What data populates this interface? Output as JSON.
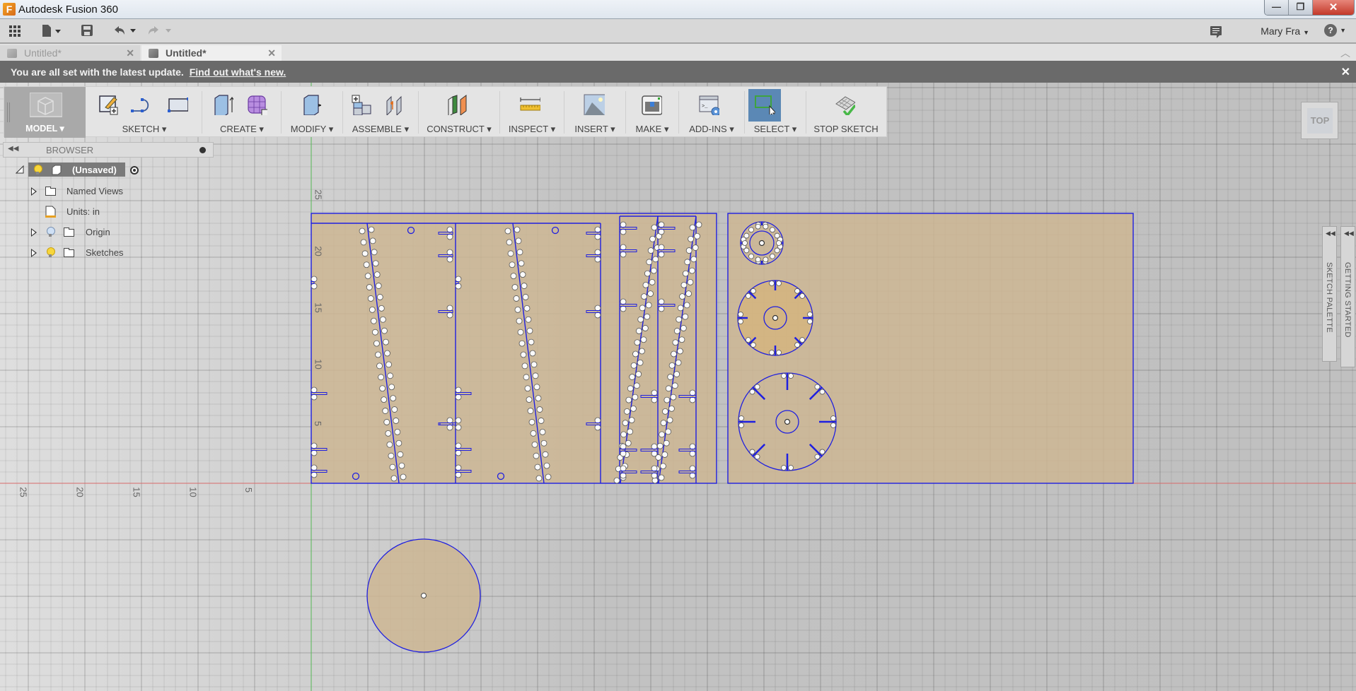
{
  "window": {
    "app_title": "Autodesk Fusion 360",
    "logo_letter": "F",
    "minimize_glyph": "—",
    "restore_glyph": "❐",
    "close_glyph": "✕"
  },
  "quick_access": {
    "user_name": "Mary Fra",
    "help_glyph": "?"
  },
  "tabs": [
    {
      "label": "Untitled*",
      "active": false
    },
    {
      "label": "Untitled*",
      "active": true
    }
  ],
  "notification": {
    "message": "You are all set with the latest update.",
    "link_text": "Find out what's new."
  },
  "ribbon": {
    "model_label": "MODEL ▾",
    "groups": [
      {
        "label": "SKETCH ▾"
      },
      {
        "label": "CREATE ▾"
      },
      {
        "label": "MODIFY ▾"
      },
      {
        "label": "ASSEMBLE ▾"
      },
      {
        "label": "CONSTRUCT ▾"
      },
      {
        "label": "INSPECT ▾"
      },
      {
        "label": "INSERT ▾"
      },
      {
        "label": "MAKE ▾"
      },
      {
        "label": "ADD-INS ▾"
      },
      {
        "label": "SELECT ▾"
      },
      {
        "label": "STOP SKETCH"
      }
    ]
  },
  "browser": {
    "title": "BROWSER",
    "root": "(Unsaved)",
    "items": [
      {
        "label": "Named Views",
        "expandable": true
      },
      {
        "label": "Units: in",
        "expandable": false
      },
      {
        "label": "Origin",
        "expandable": true
      },
      {
        "label": "Sketches",
        "expandable": true
      }
    ]
  },
  "viewcube": {
    "face": "TOP"
  },
  "side_panels": [
    {
      "label": "SKETCH PALETTE"
    },
    {
      "label": "GETTING STARTED"
    }
  ],
  "axes": {
    "x_ticks": [
      "25",
      "20",
      "15",
      "10",
      "5"
    ],
    "y_ticks": [
      "25",
      "20",
      "15",
      "10",
      "5"
    ],
    "units": "in"
  },
  "colors": {
    "sketch_line": "#1f1fe0",
    "profile_fill": "#cdb693",
    "x_axis": "#d86a6a",
    "y_axis": "#55b855",
    "select_active": "#5b88b5"
  }
}
